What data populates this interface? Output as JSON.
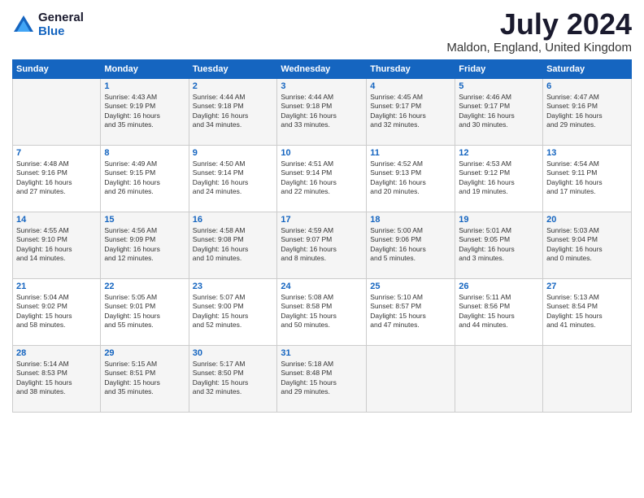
{
  "header": {
    "logo_general": "General",
    "logo_blue": "Blue",
    "month_title": "July 2024",
    "location": "Maldon, England, United Kingdom"
  },
  "days_of_week": [
    "Sunday",
    "Monday",
    "Tuesday",
    "Wednesday",
    "Thursday",
    "Friday",
    "Saturday"
  ],
  "weeks": [
    [
      {
        "day": "",
        "info": ""
      },
      {
        "day": "1",
        "info": "Sunrise: 4:43 AM\nSunset: 9:19 PM\nDaylight: 16 hours\nand 35 minutes."
      },
      {
        "day": "2",
        "info": "Sunrise: 4:44 AM\nSunset: 9:18 PM\nDaylight: 16 hours\nand 34 minutes."
      },
      {
        "day": "3",
        "info": "Sunrise: 4:44 AM\nSunset: 9:18 PM\nDaylight: 16 hours\nand 33 minutes."
      },
      {
        "day": "4",
        "info": "Sunrise: 4:45 AM\nSunset: 9:17 PM\nDaylight: 16 hours\nand 32 minutes."
      },
      {
        "day": "5",
        "info": "Sunrise: 4:46 AM\nSunset: 9:17 PM\nDaylight: 16 hours\nand 30 minutes."
      },
      {
        "day": "6",
        "info": "Sunrise: 4:47 AM\nSunset: 9:16 PM\nDaylight: 16 hours\nand 29 minutes."
      }
    ],
    [
      {
        "day": "7",
        "info": "Sunrise: 4:48 AM\nSunset: 9:16 PM\nDaylight: 16 hours\nand 27 minutes."
      },
      {
        "day": "8",
        "info": "Sunrise: 4:49 AM\nSunset: 9:15 PM\nDaylight: 16 hours\nand 26 minutes."
      },
      {
        "day": "9",
        "info": "Sunrise: 4:50 AM\nSunset: 9:14 PM\nDaylight: 16 hours\nand 24 minutes."
      },
      {
        "day": "10",
        "info": "Sunrise: 4:51 AM\nSunset: 9:14 PM\nDaylight: 16 hours\nand 22 minutes."
      },
      {
        "day": "11",
        "info": "Sunrise: 4:52 AM\nSunset: 9:13 PM\nDaylight: 16 hours\nand 20 minutes."
      },
      {
        "day": "12",
        "info": "Sunrise: 4:53 AM\nSunset: 9:12 PM\nDaylight: 16 hours\nand 19 minutes."
      },
      {
        "day": "13",
        "info": "Sunrise: 4:54 AM\nSunset: 9:11 PM\nDaylight: 16 hours\nand 17 minutes."
      }
    ],
    [
      {
        "day": "14",
        "info": "Sunrise: 4:55 AM\nSunset: 9:10 PM\nDaylight: 16 hours\nand 14 minutes."
      },
      {
        "day": "15",
        "info": "Sunrise: 4:56 AM\nSunset: 9:09 PM\nDaylight: 16 hours\nand 12 minutes."
      },
      {
        "day": "16",
        "info": "Sunrise: 4:58 AM\nSunset: 9:08 PM\nDaylight: 16 hours\nand 10 minutes."
      },
      {
        "day": "17",
        "info": "Sunrise: 4:59 AM\nSunset: 9:07 PM\nDaylight: 16 hours\nand 8 minutes."
      },
      {
        "day": "18",
        "info": "Sunrise: 5:00 AM\nSunset: 9:06 PM\nDaylight: 16 hours\nand 5 minutes."
      },
      {
        "day": "19",
        "info": "Sunrise: 5:01 AM\nSunset: 9:05 PM\nDaylight: 16 hours\nand 3 minutes."
      },
      {
        "day": "20",
        "info": "Sunrise: 5:03 AM\nSunset: 9:04 PM\nDaylight: 16 hours\nand 0 minutes."
      }
    ],
    [
      {
        "day": "21",
        "info": "Sunrise: 5:04 AM\nSunset: 9:02 PM\nDaylight: 15 hours\nand 58 minutes."
      },
      {
        "day": "22",
        "info": "Sunrise: 5:05 AM\nSunset: 9:01 PM\nDaylight: 15 hours\nand 55 minutes."
      },
      {
        "day": "23",
        "info": "Sunrise: 5:07 AM\nSunset: 9:00 PM\nDaylight: 15 hours\nand 52 minutes."
      },
      {
        "day": "24",
        "info": "Sunrise: 5:08 AM\nSunset: 8:58 PM\nDaylight: 15 hours\nand 50 minutes."
      },
      {
        "day": "25",
        "info": "Sunrise: 5:10 AM\nSunset: 8:57 PM\nDaylight: 15 hours\nand 47 minutes."
      },
      {
        "day": "26",
        "info": "Sunrise: 5:11 AM\nSunset: 8:56 PM\nDaylight: 15 hours\nand 44 minutes."
      },
      {
        "day": "27",
        "info": "Sunrise: 5:13 AM\nSunset: 8:54 PM\nDaylight: 15 hours\nand 41 minutes."
      }
    ],
    [
      {
        "day": "28",
        "info": "Sunrise: 5:14 AM\nSunset: 8:53 PM\nDaylight: 15 hours\nand 38 minutes."
      },
      {
        "day": "29",
        "info": "Sunrise: 5:15 AM\nSunset: 8:51 PM\nDaylight: 15 hours\nand 35 minutes."
      },
      {
        "day": "30",
        "info": "Sunrise: 5:17 AM\nSunset: 8:50 PM\nDaylight: 15 hours\nand 32 minutes."
      },
      {
        "day": "31",
        "info": "Sunrise: 5:18 AM\nSunset: 8:48 PM\nDaylight: 15 hours\nand 29 minutes."
      },
      {
        "day": "",
        "info": ""
      },
      {
        "day": "",
        "info": ""
      },
      {
        "day": "",
        "info": ""
      }
    ]
  ]
}
